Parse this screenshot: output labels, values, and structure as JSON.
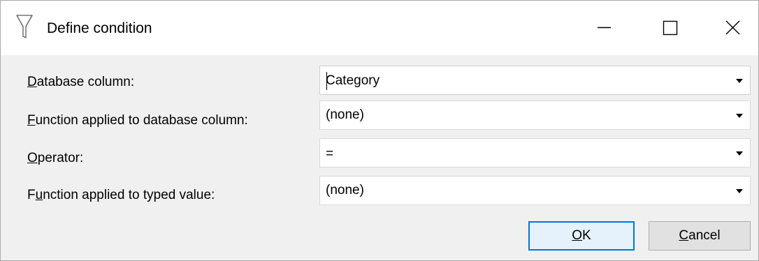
{
  "window": {
    "title": "Define condition",
    "title_icon": "filter-icon",
    "controls": {
      "minimize_icon": "minimize-icon",
      "maximize_icon": "maximize-icon",
      "close_icon": "close-icon"
    }
  },
  "fields": [
    {
      "label_mnemonic": "D",
      "label_rest": "atabase column:",
      "value": "Category"
    },
    {
      "label_mnemonic": "F",
      "label_rest": "unction applied to database column:",
      "value": "(none)"
    },
    {
      "label_mnemonic": "O",
      "label_rest": "perator:",
      "value": "="
    },
    {
      "label_prefix": "F",
      "label_mnemonic": "u",
      "label_rest": "nction applied to typed value:",
      "value": "(none)"
    }
  ],
  "buttons": {
    "ok_mnemonic": "O",
    "ok_rest": "K",
    "cancel_mnemonic": "C",
    "cancel_rest": "ancel"
  },
  "colors": {
    "accent": "#0078d7",
    "dialog_background": "#f0f0f0"
  }
}
